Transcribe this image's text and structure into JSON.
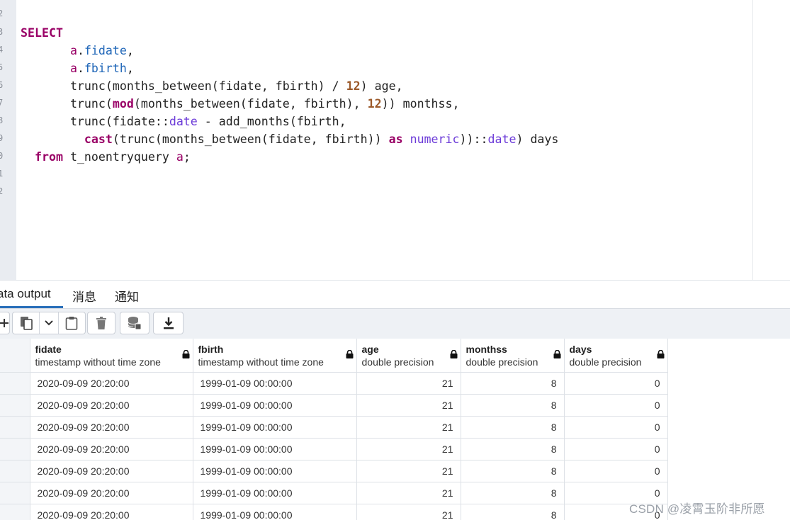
{
  "editor": {
    "line_numbers": [
      "2",
      "3",
      "4",
      "5",
      "6",
      "7",
      "8",
      "9",
      "0",
      "1",
      "2"
    ],
    "sql": [
      "SELECT",
      "       a.fidate,",
      "       a.fbirth,",
      "       trunc(months_between(fidate, fbirth) / 12) age,",
      "       trunc(mod(months_between(fidate, fbirth), 12)) monthss,",
      "       trunc(fidate::date - add_months(fbirth,",
      "         cast(trunc(months_between(fidate, fbirth)) as numeric))::date) days",
      "  from t_noentryquery a;"
    ]
  },
  "tabs": [
    "ata output",
    "消息",
    "通知"
  ],
  "toolbar": {
    "icons": [
      "plus-icon",
      "copy-icon",
      "chevron-down-icon",
      "paste-icon",
      "delete-icon",
      "database-save-icon",
      "download-icon"
    ]
  },
  "grid": {
    "columns": [
      {
        "name": "fidate",
        "type": "timestamp without time zone"
      },
      {
        "name": "fbirth",
        "type": "timestamp without time zone"
      },
      {
        "name": "age",
        "type": "double precision"
      },
      {
        "name": "monthss",
        "type": "double precision"
      },
      {
        "name": "days",
        "type": "double precision"
      }
    ],
    "rows": [
      [
        "2020-09-09 20:20:00",
        "1999-01-09 00:00:00",
        "21",
        "8",
        "0"
      ],
      [
        "2020-09-09 20:20:00",
        "1999-01-09 00:00:00",
        "21",
        "8",
        "0"
      ],
      [
        "2020-09-09 20:20:00",
        "1999-01-09 00:00:00",
        "21",
        "8",
        "0"
      ],
      [
        "2020-09-09 20:20:00",
        "1999-01-09 00:00:00",
        "21",
        "8",
        "0"
      ],
      [
        "2020-09-09 20:20:00",
        "1999-01-09 00:00:00",
        "21",
        "8",
        "0"
      ],
      [
        "2020-09-09 20:20:00",
        "1999-01-09 00:00:00",
        "21",
        "8",
        "0"
      ],
      [
        "2020-09-09 20:20:00",
        "1999-01-09 00:00:00",
        "21",
        "8",
        "0"
      ]
    ]
  },
  "watermark": "CSDN @凌霄玉阶非所愿",
  "colors": {
    "keyword": "#990066",
    "type": "#6c3bd8",
    "property": "#1f66b8",
    "number": "#9c5a2a",
    "tab_accent": "#2a6fba"
  }
}
